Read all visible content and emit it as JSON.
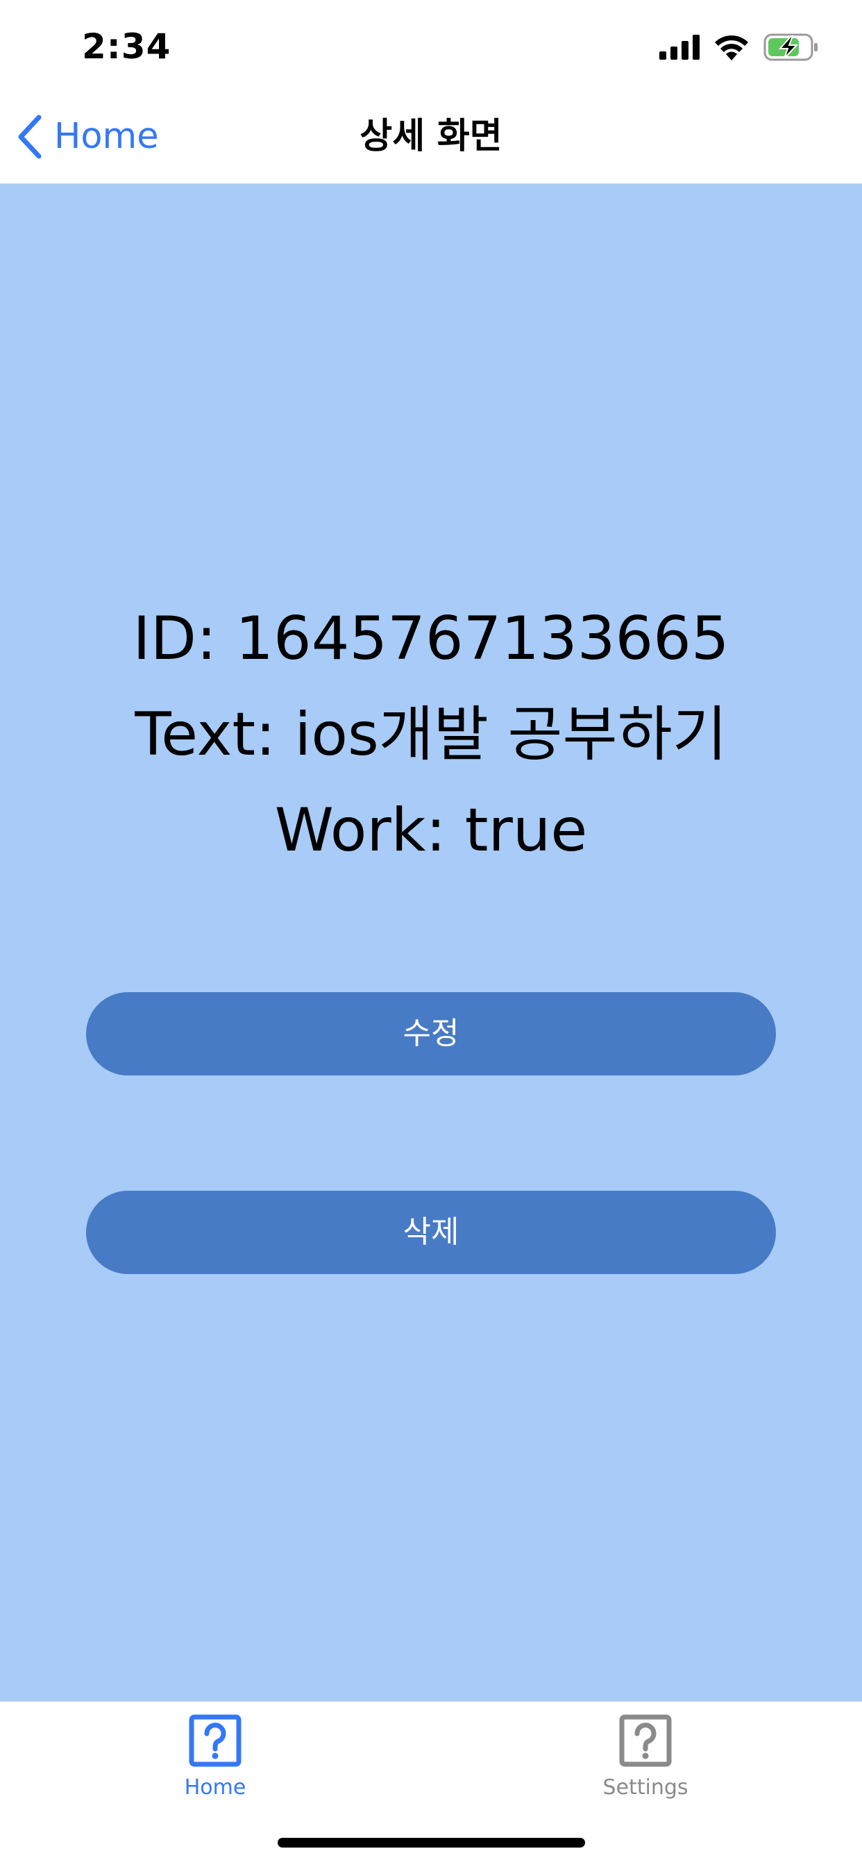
{
  "status_bar": {
    "time": "2:34",
    "icons": [
      "cellular-signal-icon",
      "wifi-icon",
      "battery-charging-icon"
    ]
  },
  "nav": {
    "back_label": "Home",
    "title": "상세 화면"
  },
  "detail": {
    "id_line": "ID: 1645767133665",
    "text_line": "Text: ios개발 공부하기",
    "work_line": "Work: true"
  },
  "actions": {
    "edit_label": "수정",
    "delete_label": "삭제"
  },
  "tab_bar": {
    "tabs": [
      {
        "label": "Home",
        "icon": "question-mark-icon",
        "selected": true
      },
      {
        "label": "Settings",
        "icon": "question-mark-icon",
        "selected": false
      }
    ]
  },
  "colors": {
    "accent": "#3478f6",
    "content_background": "#a8cbf7",
    "button_background": "#477bc5",
    "inactive_tab": "#8a8a8a"
  }
}
